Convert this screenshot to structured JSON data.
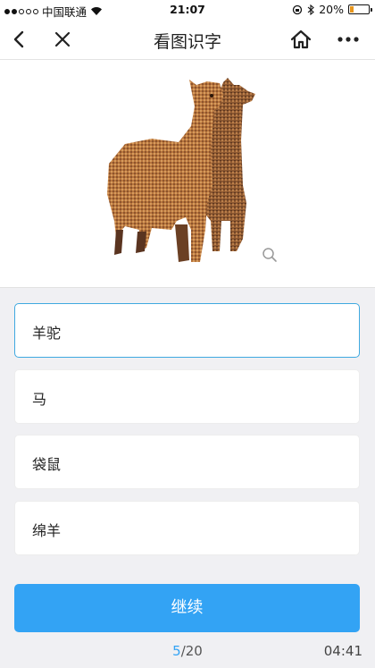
{
  "status_bar": {
    "carrier": "中国联通",
    "time": "21:07",
    "battery_percent": "20%",
    "battery_level": 0.2,
    "signal_bars_filled": 2,
    "signal_bars_total": 5
  },
  "navbar": {
    "title": "看图识字"
  },
  "options": [
    {
      "label": "羊驼",
      "selected": true
    },
    {
      "label": "马",
      "selected": false
    },
    {
      "label": "袋鼠",
      "selected": false
    },
    {
      "label": "绵羊",
      "selected": false
    }
  ],
  "continue_label": "继续",
  "progress": {
    "current": "5",
    "total": "/20"
  },
  "timer": "04:41",
  "colors": {
    "accent": "#33a3f4",
    "selected_border": "#3fa9e0",
    "alpaca_light": "#c88a4e",
    "alpaca_dark": "#4a2a18"
  }
}
